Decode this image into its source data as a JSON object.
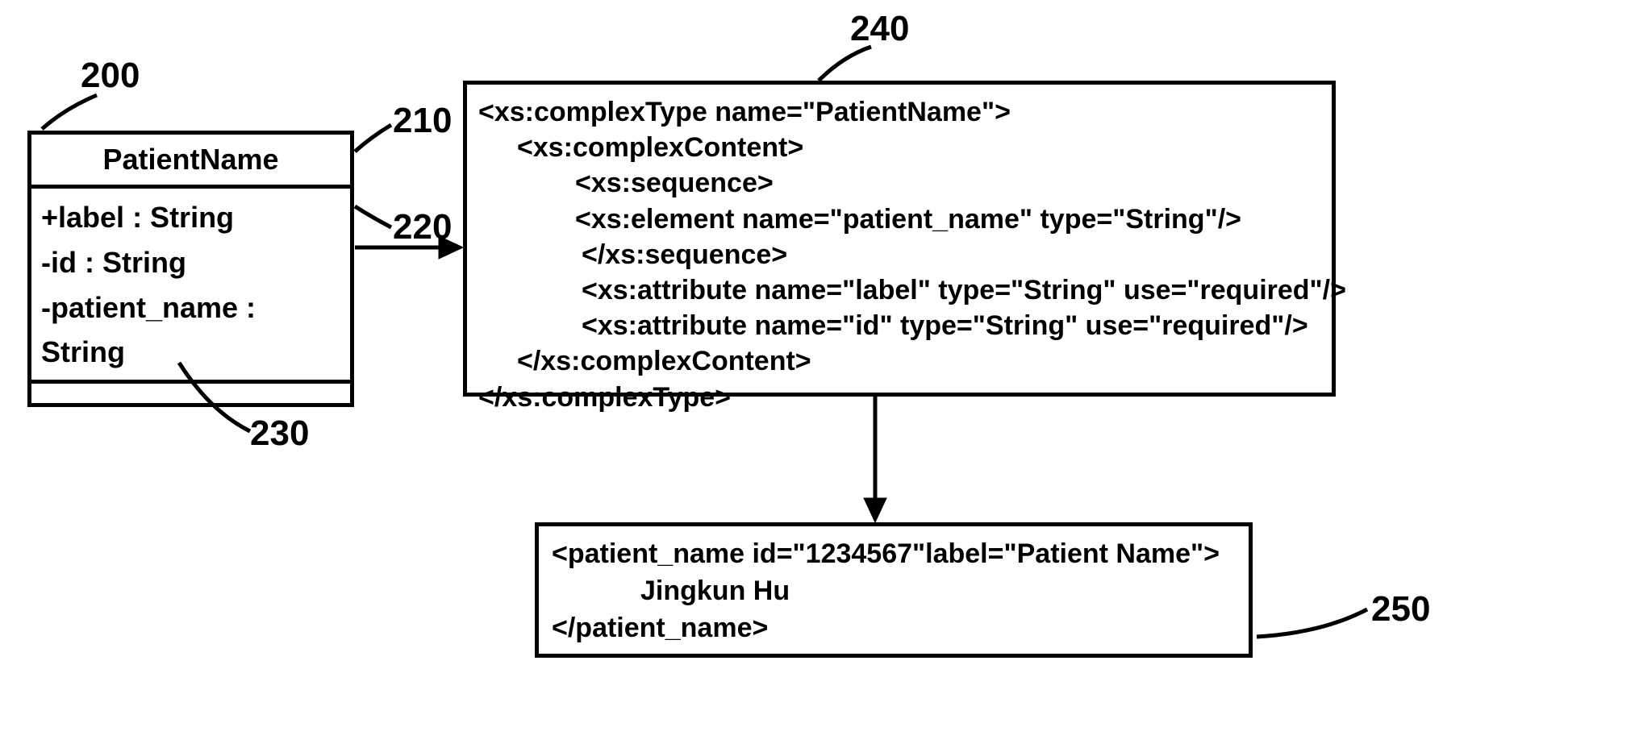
{
  "labels": {
    "uml_ref": "200",
    "title_ref": "210",
    "attrs_ref": "220",
    "ops_ref": "230",
    "schema_ref": "240",
    "instance_ref": "250"
  },
  "uml": {
    "class_name": "PatientName",
    "attrs": {
      "a1": "+label : String",
      "a2": "-id : String",
      "a3": "-patient_name : String"
    }
  },
  "schema": {
    "l1": "<xs:complexType name=\"PatientName\">",
    "l2": "<xs:complexContent>",
    "l3": "<xs:sequence>",
    "l4": "<xs:element name=\"patient_name\" type=\"String\"/>",
    "l5": "</xs:sequence>",
    "l6": "<xs:attribute name=\"label\" type=\"String\" use=\"required\"/>",
    "l7": "<xs:attribute name=\"id\" type=\"String\" use=\"required\"/>",
    "l8": "</xs:complexContent>",
    "l9": "</xs:complexType>"
  },
  "instance": {
    "l1": "<patient_name id=\"1234567\"label=\"Patient Name\">",
    "l2": "Jingkun Hu",
    "l3": "</patient_name>"
  }
}
